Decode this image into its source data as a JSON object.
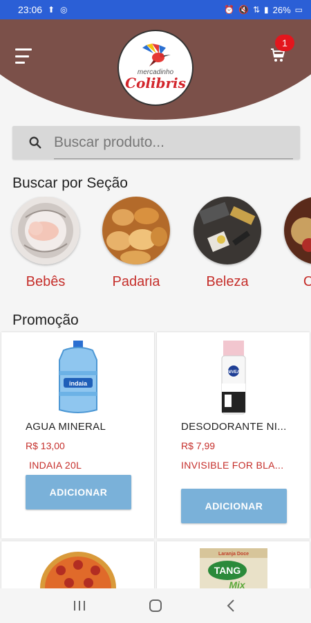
{
  "status": {
    "time": "23:06",
    "battery": "26%"
  },
  "header": {
    "logo_small": "mercadinho",
    "logo_big": "Colibris",
    "cart_count": "1"
  },
  "search": {
    "placeholder": "Buscar produto..."
  },
  "sections": {
    "title": "Buscar por Seção",
    "items": [
      {
        "label": "Bebês"
      },
      {
        "label": "Padaria"
      },
      {
        "label": "Beleza"
      },
      {
        "label": "Com"
      }
    ]
  },
  "promo": {
    "title": "Promoção",
    "products": [
      {
        "name": "AGUA MINERAL",
        "price": "R$ 13,00",
        "desc": "INDAIA 20L",
        "button": "ADICIONAR"
      },
      {
        "name": "DESODORANTE NI...",
        "price": "R$ 7,99",
        "desc": "INVISIBLE FOR BLA...",
        "button": "ADICIONAR"
      }
    ],
    "preview_labels": {
      "tang": "TANG",
      "mix": "Mix",
      "laranja": "Laranja Doce"
    }
  },
  "colors": {
    "header_bg": "#7b5049",
    "accent_red": "#c52e2a",
    "button_blue": "#7ab1d9",
    "status_blue": "#2b5fd6"
  }
}
